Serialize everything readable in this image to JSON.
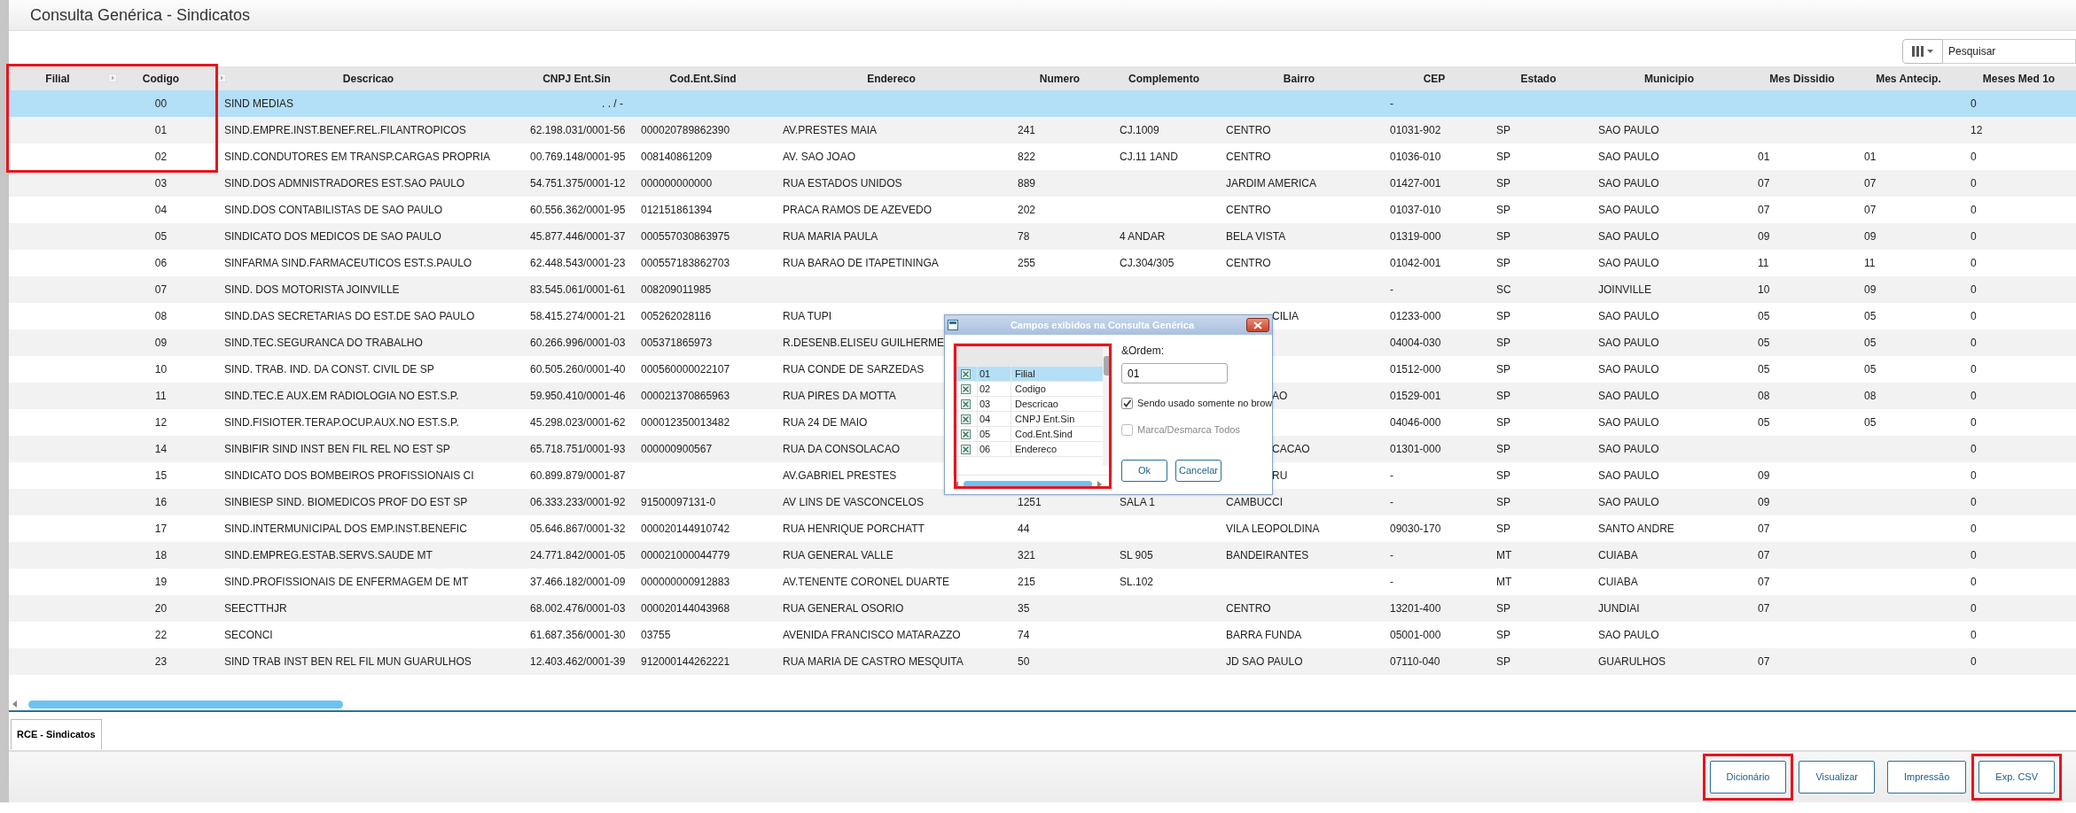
{
  "window": {
    "title": "Consulta Genérica - Sindicatos"
  },
  "toolbar": {
    "search": {
      "placeholder": "Pesquisar"
    }
  },
  "table": {
    "columns": [
      {
        "label": "Filial",
        "arrow": false,
        "highlighted": true
      },
      {
        "label": "Codigo",
        "arrow": true,
        "highlighted": true
      },
      {
        "label": "Descricao",
        "arrow": true,
        "highlighted": false
      },
      {
        "label": "CNPJ Ent.Sin",
        "arrow": false,
        "highlighted": false
      },
      {
        "label": "Cod.Ent.Sind",
        "arrow": false,
        "highlighted": false
      },
      {
        "label": "Endereco",
        "arrow": false,
        "highlighted": false
      },
      {
        "label": "Numero",
        "arrow": false,
        "highlighted": false
      },
      {
        "label": "Complemento",
        "arrow": false,
        "highlighted": false
      },
      {
        "label": "Bairro",
        "arrow": false,
        "highlighted": false
      },
      {
        "label": "CEP",
        "arrow": false,
        "highlighted": false
      },
      {
        "label": "Estado",
        "arrow": false,
        "highlighted": false
      },
      {
        "label": "Municipio",
        "arrow": false,
        "highlighted": false
      },
      {
        "label": "Mes Dissidio",
        "arrow": false,
        "highlighted": false
      },
      {
        "label": "Mes Antecip.",
        "arrow": false,
        "highlighted": false
      },
      {
        "label": "Meses Med 1o",
        "arrow": false,
        "highlighted": false
      }
    ],
    "rows": [
      {
        "selected": true,
        "highlighted": true,
        "cells": [
          null,
          "00",
          "SIND MEDIAS",
          ". . / -",
          null,
          null,
          null,
          null,
          null,
          "-",
          null,
          null,
          null,
          null,
          "0"
        ]
      },
      {
        "selected": false,
        "highlighted": true,
        "cells": [
          null,
          "01",
          "SIND.EMPRE.INST.BENEF.REL.FILANTROPICOS",
          "62.198.031/0001-56",
          "000020789862390",
          "AV.PRESTES MAIA",
          "241",
          "CJ.1009",
          "CENTRO",
          "01031-902",
          "SP",
          "SAO PAULO",
          null,
          null,
          "12"
        ]
      },
      {
        "selected": false,
        "highlighted": true,
        "cells": [
          null,
          "02",
          "SIND.CONDUTORES EM TRANSP.CARGAS PROPRIA",
          "00.769.148/0001-95",
          "008140861209",
          "AV. SAO JOAO",
          "822",
          "CJ.11 1AND",
          "CENTRO",
          "01036-010",
          "SP",
          "SAO PAULO",
          "01",
          "01",
          "0"
        ]
      },
      {
        "selected": false,
        "highlighted": false,
        "cells": [
          null,
          "03",
          "SIND.DOS ADMNISTRADORES EST.SAO PAULO",
          "54.751.375/0001-12",
          "000000000000",
          "RUA ESTADOS UNIDOS",
          "889",
          null,
          "JARDIM AMERICA",
          "01427-001",
          "SP",
          "SAO PAULO",
          "07",
          "07",
          "0"
        ]
      },
      {
        "selected": false,
        "highlighted": false,
        "cells": [
          null,
          "04",
          "SIND.DOS CONTABILISTAS DE SAO PAULO",
          "60.556.362/0001-95",
          "012151861394",
          "PRACA RAMOS DE AZEVEDO",
          "202",
          null,
          "CENTRO",
          "01037-010",
          "SP",
          "SAO PAULO",
          "07",
          "07",
          "0"
        ]
      },
      {
        "selected": false,
        "highlighted": false,
        "cells": [
          null,
          "05",
          "SINDICATO DOS MEDICOS DE SAO PAULO",
          "45.877.446/0001-37",
          "000557030863975",
          "RUA MARIA PAULA",
          "78",
          "4 ANDAR",
          "BELA VISTA",
          "01319-000",
          "SP",
          "SAO PAULO",
          "09",
          "09",
          "0"
        ]
      },
      {
        "selected": false,
        "highlighted": false,
        "cells": [
          null,
          "06",
          "SINFARMA SIND.FARMACEUTICOS EST.S.PAULO",
          "62.448.543/0001-23",
          "000557183862703",
          "RUA BARAO DE ITAPETININGA",
          "255",
          "CJ.304/305",
          "CENTRO",
          "01042-001",
          "SP",
          "SAO PAULO",
          "11",
          "11",
          "0"
        ]
      },
      {
        "selected": false,
        "highlighted": false,
        "cells": [
          null,
          "07",
          "SIND. DOS MOTORISTA JOINVILLE",
          "83.545.061/0001-61",
          "008209011985",
          null,
          null,
          null,
          null,
          "-",
          "SC",
          "JOINVILLE",
          "10",
          "09",
          "0"
        ]
      },
      {
        "selected": false,
        "highlighted": false,
        "cells": [
          null,
          "08",
          "SIND.DAS SECRETARIAS DO EST.DE SAO PAULO",
          "58.415.274/0001-21",
          "005262028116",
          "RUA TUPI",
          null,
          null,
          {
            "text": "CILIA",
            "covered": true
          },
          "01233-000",
          "SP",
          "SAO PAULO",
          "05",
          "05",
          "0"
        ]
      },
      {
        "selected": false,
        "highlighted": false,
        "cells": [
          null,
          "09",
          "SIND.TEC.SEGURANCA DO TRABALHO",
          "60.266.996/0001-03",
          "005371865973",
          "R.DESENB.ELISEU GUILHERME",
          null,
          null,
          null,
          "04004-030",
          "SP",
          "SAO PAULO",
          "05",
          "05",
          "0"
        ]
      },
      {
        "selected": false,
        "highlighted": false,
        "cells": [
          null,
          "10",
          "SIND. TRAB. IND. DA CONST. CIVIL DE SP",
          "60.505.260/0001-40",
          "000560000022107",
          "RUA CONDE DE SARZEDAS",
          null,
          null,
          null,
          "01512-000",
          "SP",
          "SAO PAULO",
          "05",
          "05",
          "0"
        ]
      },
      {
        "selected": false,
        "highlighted": false,
        "cells": [
          null,
          "11",
          "SIND.TEC.E AUX.EM RADIOLOGIA NO EST.S.P.",
          "59.950.410/0001-46",
          "000021370865963",
          "RUA PIRES DA MOTTA",
          null,
          null,
          {
            "text": "AO",
            "covered": true
          },
          "01529-001",
          "SP",
          "SAO PAULO",
          "08",
          "08",
          "0"
        ]
      },
      {
        "selected": false,
        "highlighted": false,
        "cells": [
          null,
          "12",
          "SIND.FISIOTER.TERAP.OCUP.AUX.NO EST.S.P.",
          "45.298.023/0001-62",
          "000012350013482",
          "RUA 24 DE MAIO",
          null,
          null,
          null,
          "04046-000",
          "SP",
          "SAO PAULO",
          "05",
          "05",
          "0"
        ]
      },
      {
        "selected": false,
        "highlighted": false,
        "cells": [
          null,
          "14",
          "SINBIFIR SIND INST BEN FIL REL NO EST SP",
          "65.718.751/0001-93",
          "000000900567",
          "RUA DA CONSOLACAO",
          null,
          null,
          {
            "text": "CACAO",
            "covered": true
          },
          "01301-000",
          "SP",
          "SAO PAULO",
          null,
          null,
          "0"
        ]
      },
      {
        "selected": false,
        "highlighted": false,
        "cells": [
          null,
          "15",
          "SINDICATO DOS BOMBEIROS PROFISSIONAIS CI",
          "60.899.879/0001-87",
          null,
          "AV.GABRIEL PRESTES",
          null,
          null,
          {
            "text": "RU",
            "covered": true
          },
          "-",
          "SP",
          "SAO PAULO",
          "09",
          null,
          "0"
        ]
      },
      {
        "selected": false,
        "highlighted": false,
        "cells": [
          null,
          "16",
          "SINBIESP SIND. BIOMEDICOS PROF DO EST SP",
          "06.333.233/0001-92",
          "91500097131-0",
          "AV LINS DE VASCONCELOS",
          "1251",
          "SALA 1",
          "CAMBUCCI",
          "-",
          "SP",
          "SAO PAULO",
          "09",
          null,
          "0"
        ]
      },
      {
        "selected": false,
        "highlighted": false,
        "cells": [
          null,
          "17",
          "SIND.INTERMUNICIPAL DOS EMP.INST.BENEFIC",
          "05.646.867/0001-32",
          "000020144910742",
          "RUA HENRIQUE PORCHATT",
          "44",
          null,
          "VILA LEOPOLDINA",
          "09030-170",
          "SP",
          "SANTO ANDRE",
          "07",
          null,
          "0"
        ]
      },
      {
        "selected": false,
        "highlighted": false,
        "cells": [
          null,
          "18",
          "SIND.EMPREG.ESTAB.SERVS.SAUDE MT",
          "24.771.842/0001-05",
          "000021000044779",
          "RUA GENERAL VALLE",
          "321",
          "SL 905",
          "BANDEIRANTES",
          "-",
          "MT",
          "CUIABA",
          "07",
          null,
          "0"
        ]
      },
      {
        "selected": false,
        "highlighted": false,
        "cells": [
          null,
          "19",
          "SIND.PROFISSIONAIS DE ENFERMAGEM DE MT",
          "37.466.182/0001-09",
          "000000000912883",
          "AV.TENENTE CORONEL DUARTE",
          "215",
          "SL.102",
          null,
          "-",
          "MT",
          "CUIABA",
          "07",
          null,
          "0"
        ]
      },
      {
        "selected": false,
        "highlighted": false,
        "cells": [
          null,
          "20",
          "SEECTTHJR",
          "68.002.476/0001-03",
          "000020144043968",
          "RUA GENERAL OSORIO",
          "35",
          null,
          "CENTRO",
          "13201-400",
          "SP",
          "JUNDIAI",
          "07",
          null,
          "0"
        ]
      },
      {
        "selected": false,
        "highlighted": false,
        "cells": [
          null,
          "22",
          "SECONCI",
          "61.687.356/0001-30",
          "03755",
          "AVENIDA FRANCISCO MATARAZZO",
          "74",
          null,
          "BARRA FUNDA",
          "05001-000",
          "SP",
          "SAO PAULO",
          null,
          null,
          "0"
        ]
      },
      {
        "selected": false,
        "highlighted": false,
        "cells": [
          null,
          "23",
          "SIND TRAB INST BEN REL FIL MUN GUARULHOS",
          "12.403.462/0001-39",
          "912000144262221",
          "RUA MARIA DE CASTRO MESQUITA",
          "50",
          null,
          "JD SAO PAULO",
          "07110-040",
          "SP",
          "GUARULHOS",
          "07",
          null,
          "0"
        ]
      }
    ]
  },
  "dialog": {
    "title": "Campos exibidos na Consulta Genérica",
    "list": {
      "highlighted": true,
      "items": [
        {
          "code": "01",
          "label": "Filial",
          "checked": true,
          "selected": true
        },
        {
          "code": "02",
          "label": "Codigo",
          "checked": true,
          "selected": false
        },
        {
          "code": "03",
          "label": "Descricao",
          "checked": true,
          "selected": false
        },
        {
          "code": "04",
          "label": "CNPJ Ent.Sin",
          "checked": true,
          "selected": false
        },
        {
          "code": "05",
          "label": "Cod.Ent.Sind",
          "checked": true,
          "selected": false
        },
        {
          "code": "06",
          "label": "Endereco",
          "checked": true,
          "selected": false
        }
      ]
    },
    "order_label": "&Ordem:",
    "order_value": "01",
    "checkboxes": [
      {
        "label": "Sendo usado somente no brow",
        "checked": true,
        "disabled": false
      },
      {
        "label": "Marca/Desmarca Todos",
        "checked": false,
        "disabled": true
      }
    ],
    "buttons": [
      "Ok",
      "Cancelar"
    ]
  },
  "tabs": [
    {
      "label": "RCE - Sindicatos",
      "selected": true
    }
  ],
  "buttons": [
    {
      "label": "Dicionário",
      "highlighted": true
    },
    {
      "label": "Visualizar",
      "highlighted": false
    },
    {
      "label": "Impressão",
      "highlighted": false
    },
    {
      "label": "Exp. CSV",
      "highlighted": true
    }
  ]
}
